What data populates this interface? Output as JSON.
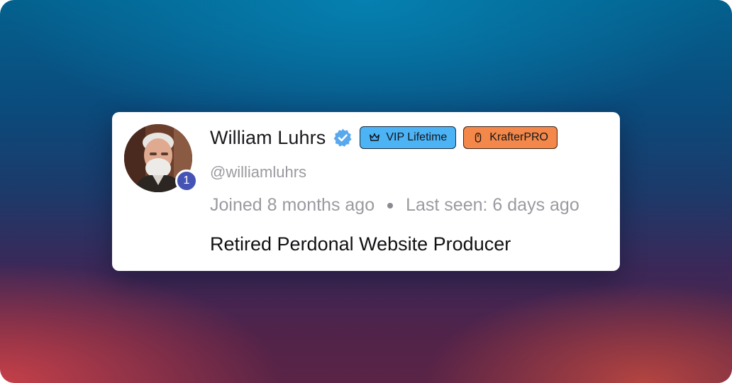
{
  "profile": {
    "name": "William Luhrs",
    "handle": "@williamluhrs",
    "level": "1",
    "joined": "Joined 8 months ago",
    "last_seen": "Last seen: 6 days ago",
    "bio": "Retired Perdonal Website Producer",
    "verified": true
  },
  "badges": {
    "vip": {
      "label": "VIP Lifetime",
      "icon": "crown-icon",
      "color": "#4cb3f4"
    },
    "pro": {
      "label": "KrafterPRO",
      "icon": "mouse-icon",
      "color": "#f3884a"
    }
  },
  "colors": {
    "verified_badge": "#58a8ef",
    "level_badge": "#4554b4"
  }
}
